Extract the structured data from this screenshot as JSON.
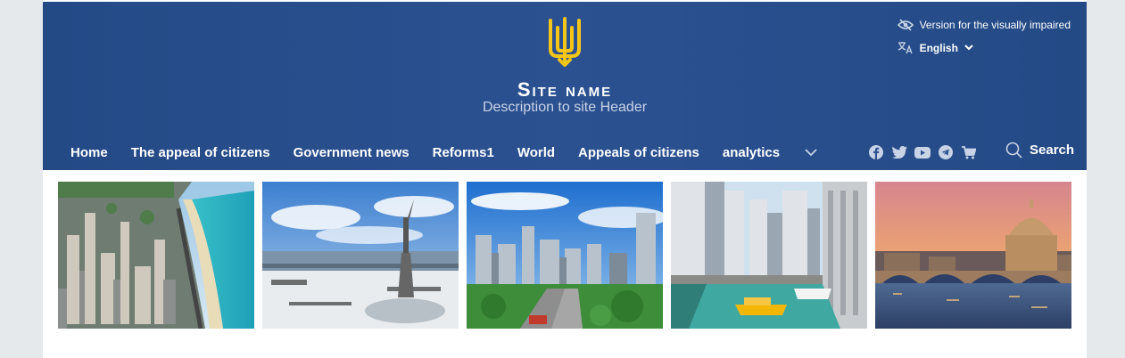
{
  "header": {
    "site_title": "Site name",
    "site_description": "Description to site Header",
    "accessibility_label": "Version for the visually impaired",
    "language_label": "English"
  },
  "nav": {
    "items": [
      {
        "label": "Home"
      },
      {
        "label": "The appeal of citizens"
      },
      {
        "label": "Government news"
      },
      {
        "label": "Reforms1"
      },
      {
        "label": "World"
      },
      {
        "label": "Appeals of citizens"
      },
      {
        "label": "analytics"
      }
    ],
    "more_icon": "chevron-down-icon"
  },
  "socials": [
    "facebook-icon",
    "twitter-icon",
    "youtube-icon",
    "telegram-icon",
    "cart-icon"
  ],
  "search": {
    "label": "Search",
    "icon": "search-icon"
  },
  "gallery": [
    "coastal-city-aerial",
    "winter-monument-river",
    "city-highway-skyline",
    "river-skyscrapers-boat",
    "sunset-bridge-dome"
  ],
  "colors": {
    "header_bg": "#2b5191",
    "accent_yellow": "#f5c518",
    "page_bg": "#e6e9ec",
    "text_light": "#ffffff"
  }
}
